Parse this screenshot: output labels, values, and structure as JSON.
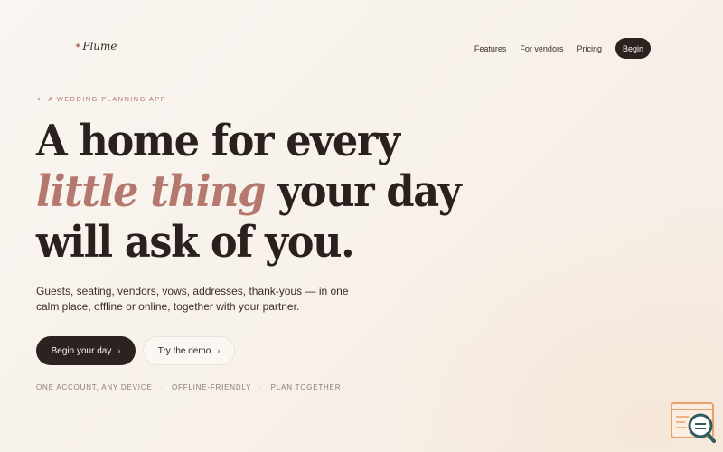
{
  "brand": {
    "name": "Plume",
    "mark": "✦"
  },
  "nav": {
    "links": [
      "Features",
      "For vendors",
      "Pricing"
    ],
    "cta": "Begin"
  },
  "hero": {
    "eyebrow": "A WEDDING PLANNING APP",
    "eyebrow_mark": "✦",
    "headline": {
      "line1": "A home for every",
      "line2_accent": "little thing",
      "line2_rest": " your day",
      "line3": "will ask of you."
    },
    "subtext": "Guests, seating, vendors, vows, addresses, thank-yous — in one calm place, offline or online, together with your partner.",
    "primary_button": "Begin your day",
    "secondary_button": "Try the demo",
    "chevron": "›",
    "features": [
      "ONE ACCOUNT, ANY DEVICE",
      "OFFLINE-FRIENDLY",
      "PLAN TOGETHER"
    ],
    "feature_separator": "·"
  },
  "colors": {
    "accent": "#b5786f",
    "dark": "#2c2320",
    "background": "#f8f3ed"
  },
  "icons": {
    "corner_widget": "search-window-icon"
  }
}
